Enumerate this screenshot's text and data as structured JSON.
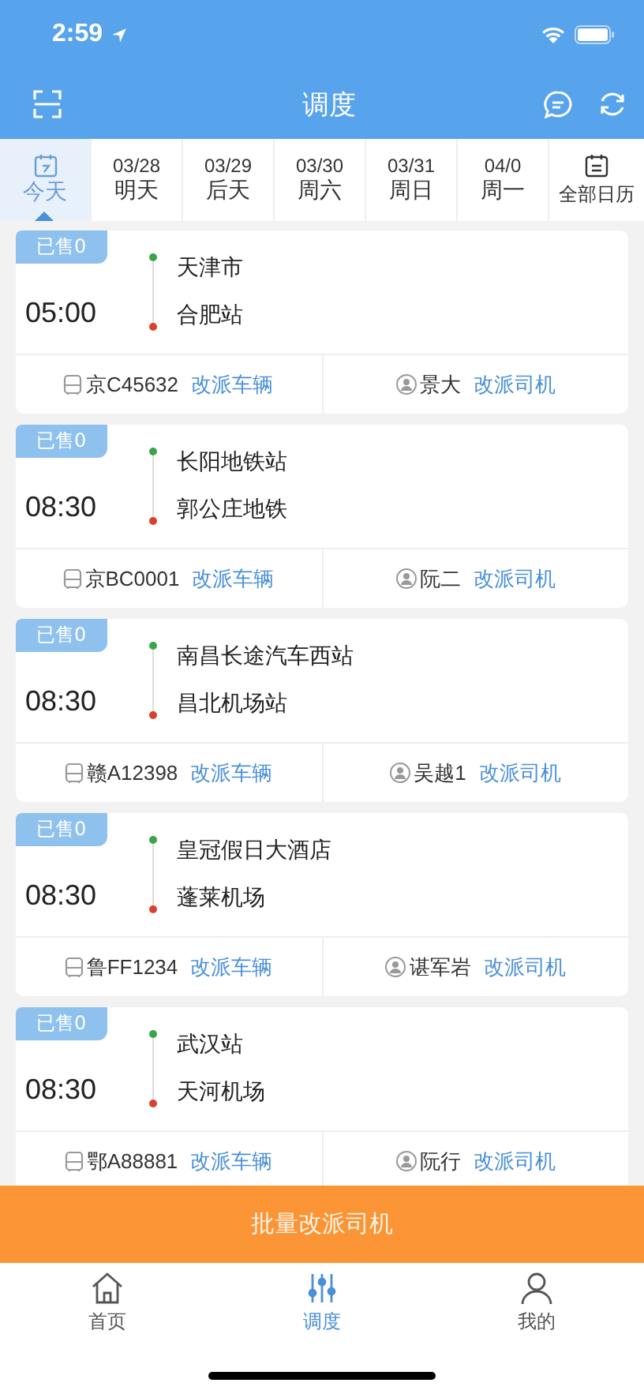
{
  "status_bar": {
    "time": "2:59"
  },
  "nav": {
    "title": "调度"
  },
  "date_tabs": [
    {
      "kind": "today",
      "label": "今天",
      "selected": true
    },
    {
      "kind": "date",
      "date": "03/28",
      "label": "明天",
      "selected": false
    },
    {
      "kind": "date",
      "date": "03/29",
      "label": "后天",
      "selected": false
    },
    {
      "kind": "date",
      "date": "03/30",
      "label": "周六",
      "selected": false
    },
    {
      "kind": "date",
      "date": "03/31",
      "label": "周日",
      "selected": false
    },
    {
      "kind": "date",
      "date": "04/0",
      "label": "周一",
      "selected": false
    }
  ],
  "calendar_button": {
    "label": "全部日历"
  },
  "trips": [
    {
      "sold": "已售0",
      "time": "05:00",
      "from": "天津市",
      "to": "合肥站",
      "plate": "京C45632",
      "change_vehicle": "改派车辆",
      "driver": "景大",
      "change_driver": "改派司机"
    },
    {
      "sold": "已售0",
      "time": "08:30",
      "from": "长阳地铁站",
      "to": "郭公庄地铁",
      "plate": "京BC0001",
      "change_vehicle": "改派车辆",
      "driver": "阮二",
      "change_driver": "改派司机"
    },
    {
      "sold": "已售0",
      "time": "08:30",
      "from": "南昌长途汽车西站",
      "to": "昌北机场站",
      "plate": "赣A12398",
      "change_vehicle": "改派车辆",
      "driver": "吴越1",
      "change_driver": "改派司机"
    },
    {
      "sold": "已售0",
      "time": "08:30",
      "from": "皇冠假日大酒店",
      "to": "蓬莱机场",
      "plate": "鲁FF1234",
      "change_vehicle": "改派车辆",
      "driver": "谌军岩",
      "change_driver": "改派司机"
    },
    {
      "sold": "已售0",
      "time": "08:30",
      "from": "武汉站",
      "to": "天河机场",
      "plate": "鄂A88881",
      "change_vehicle": "改派车辆",
      "driver": "阮行",
      "change_driver": "改派司机"
    }
  ],
  "batch_button": {
    "label": "批量改派司机"
  },
  "tab_bar": [
    {
      "kind": "home",
      "label": "首页",
      "selected": false
    },
    {
      "kind": "dispatch",
      "label": "调度",
      "selected": true
    },
    {
      "kind": "me",
      "label": "我的",
      "selected": false
    }
  ]
}
